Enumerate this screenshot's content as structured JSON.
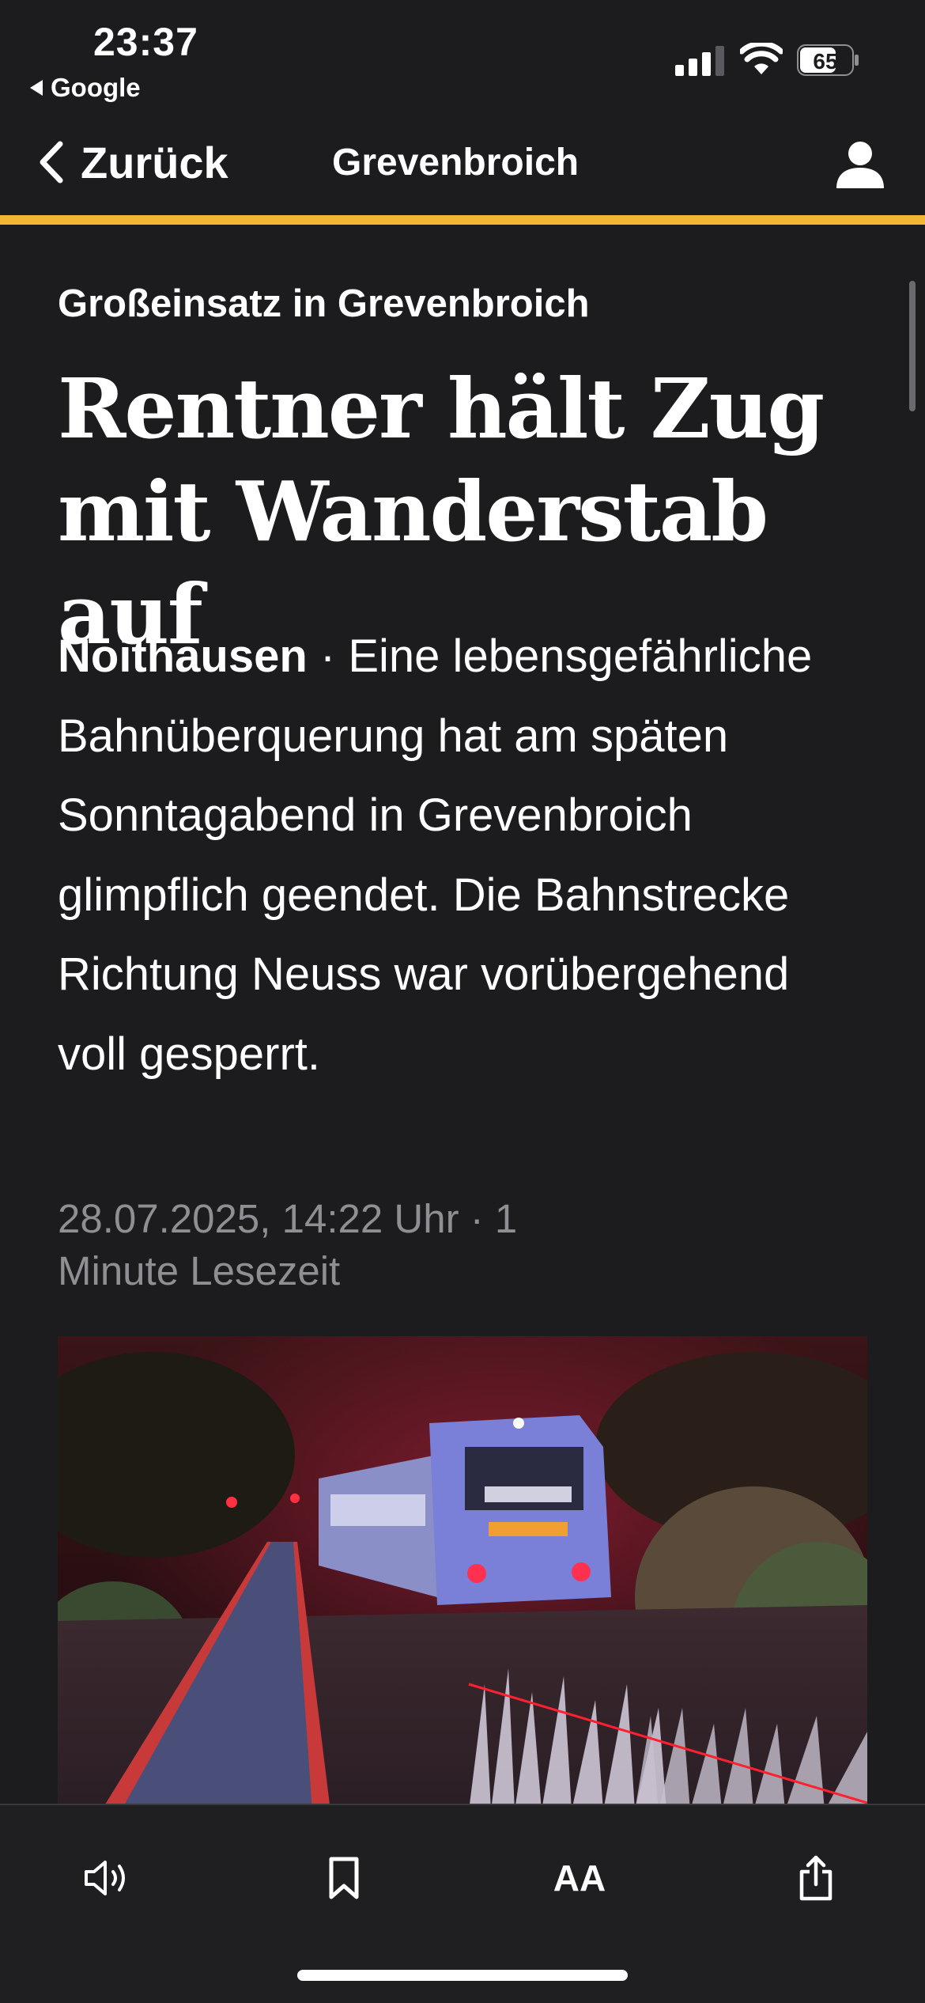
{
  "status_bar": {
    "time": "23:37",
    "back_app": "Google",
    "battery": "65",
    "icons": [
      "cellular-signal-icon",
      "wifi-icon",
      "battery-icon"
    ]
  },
  "nav": {
    "back_label": "Zurück",
    "title": "Grevenbroich",
    "accent_color": "#f2b632",
    "icons": [
      "chevron-left-icon",
      "profile-icon"
    ]
  },
  "article": {
    "kicker": "Großeinsatz in Grevenbroich",
    "headline": "Rentner hält Zug mit Wanderstab auf",
    "teaser_place": "Noithausen",
    "teaser_text": " · Eine lebensgefährliche Bahnüberquerung hat am späten Sonntagabend in Grevenbroich glimpflich geendet. Die Bahnstrecke Richtung Neuss war vorübergehend voll gesperrt.",
    "meta": "28.07.2025, 14:22 Uhr · 1 Minute Lesezeit"
  },
  "toolbar": {
    "text_size_label": "AA",
    "icons": [
      "speaker-icon",
      "bookmark-icon",
      "text-size-icon",
      "share-icon"
    ]
  }
}
